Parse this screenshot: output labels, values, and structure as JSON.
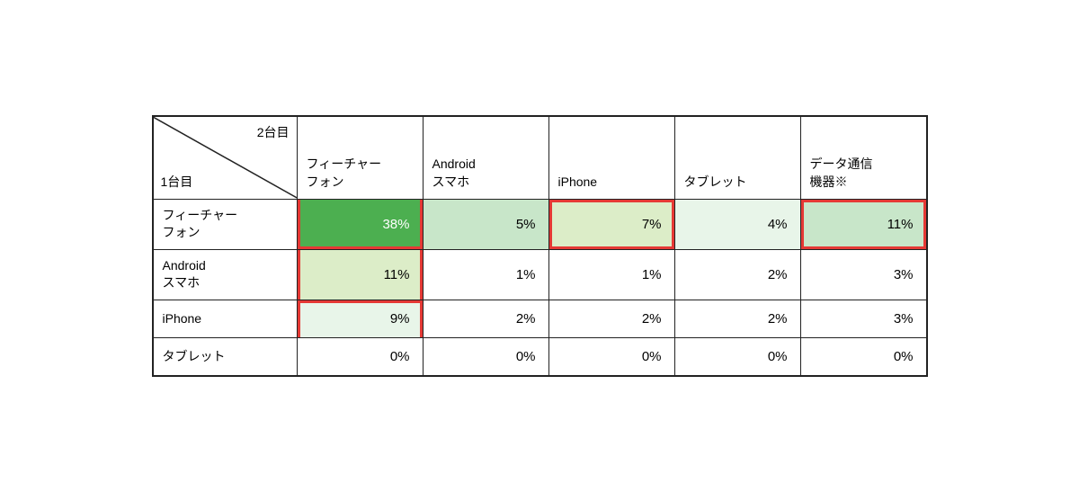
{
  "table": {
    "corner": {
      "top_label": "2台目",
      "bottom_label": "1台目"
    },
    "col_headers": [
      "フィーチャー\nフォン",
      "Android\nスマホ",
      "iPhone",
      "タブレット",
      "データ通信\n機器※"
    ],
    "rows": [
      {
        "label": "フィーチャー\nフォン",
        "values": [
          "38%",
          "5%",
          "7%",
          "4%",
          "11%"
        ],
        "colors": [
          "green-dark",
          "green-light1",
          "green-light2",
          "green-light3",
          "green-light1"
        ]
      },
      {
        "label": "Android\nスマホ",
        "values": [
          "11%",
          "1%",
          "1%",
          "2%",
          "3%"
        ],
        "colors": [
          "green-light2",
          "white-cell",
          "white-cell",
          "white-cell",
          "white-cell"
        ]
      },
      {
        "label": "iPhone",
        "values": [
          "9%",
          "2%",
          "2%",
          "2%",
          "3%"
        ],
        "colors": [
          "green-light3",
          "white-cell",
          "white-cell",
          "white-cell",
          "white-cell"
        ]
      },
      {
        "label": "タブレット",
        "values": [
          "0%",
          "0%",
          "0%",
          "0%",
          "0%"
        ],
        "colors": [
          "white-cell",
          "white-cell",
          "white-cell",
          "white-cell",
          "white-cell"
        ]
      }
    ]
  }
}
